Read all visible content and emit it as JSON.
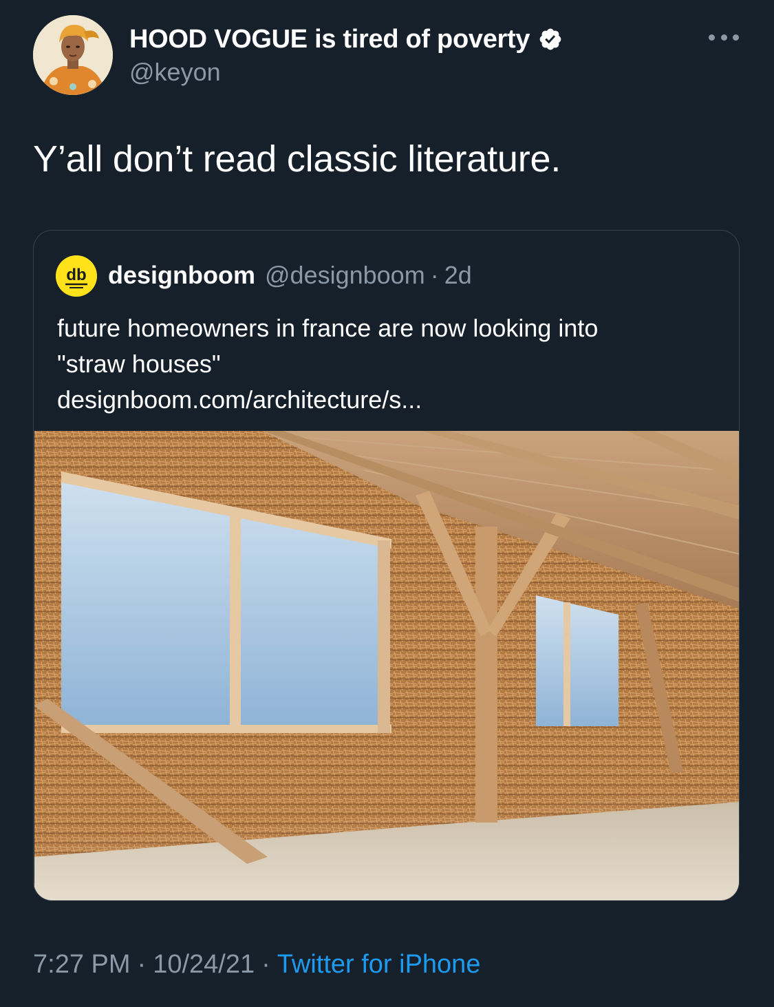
{
  "tweet": {
    "display_name": "HOOD VOGUE is tired of poverty",
    "handle": "@keyon",
    "verified": true,
    "text": "Y’all don’t read classic literature.",
    "more_icon": "more-dots-icon"
  },
  "quoted_tweet": {
    "display_name": "designboom",
    "handle": "@designboom",
    "separator": "·",
    "age": "2d",
    "avatar_text": "db",
    "text_lines": [
      "future homeowners in france are now looking into",
      "\"straw houses\"",
      "designboom.com/architecture/s..."
    ],
    "image_icon": "straw-house-photo"
  },
  "footer": {
    "time": "7:27 PM",
    "separator": "·",
    "date": "10/24/21",
    "source": "Twitter for iPhone"
  },
  "colors": {
    "background": "#15202b",
    "text": "#ffffff",
    "secondary": "#8b98a5",
    "accent": "#1d9bf0",
    "border": "#38444d",
    "designboom_yellow": "#ffe21a"
  }
}
